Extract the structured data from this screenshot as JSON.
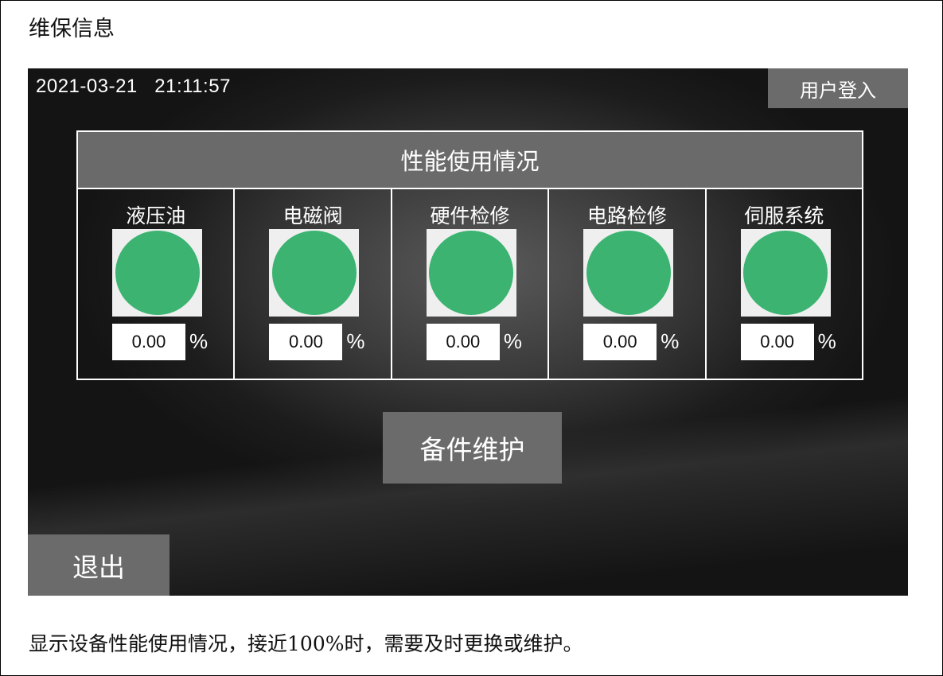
{
  "document": {
    "title": "维保信息",
    "caption": "显示设备性能使用情况，接近100%时，需要及时更换或维护。"
  },
  "hmi": {
    "datetime": "2021-03-21   21:11:57",
    "login_label": "用户登入",
    "panel_title": "性能使用情况",
    "indicator_color": "#3cb371",
    "items": [
      {
        "label": "液压油",
        "value": "0.00",
        "unit": "%",
        "usage_percent": 0.0,
        "icon": "status-lamp-icon"
      },
      {
        "label": "电磁阀",
        "value": "0.00",
        "unit": "%",
        "usage_percent": 0.0,
        "icon": "status-lamp-icon"
      },
      {
        "label": "硬件检修",
        "value": "0.00",
        "unit": "%",
        "usage_percent": 0.0,
        "icon": "status-lamp-icon"
      },
      {
        "label": "电路检修",
        "value": "0.00",
        "unit": "%",
        "usage_percent": 0.0,
        "icon": "status-lamp-icon"
      },
      {
        "label": "伺服系统",
        "value": "0.00",
        "unit": "%",
        "usage_percent": 0.0,
        "icon": "status-lamp-icon"
      }
    ],
    "spare_button_label": "备件维护",
    "exit_button_label": "退出"
  }
}
